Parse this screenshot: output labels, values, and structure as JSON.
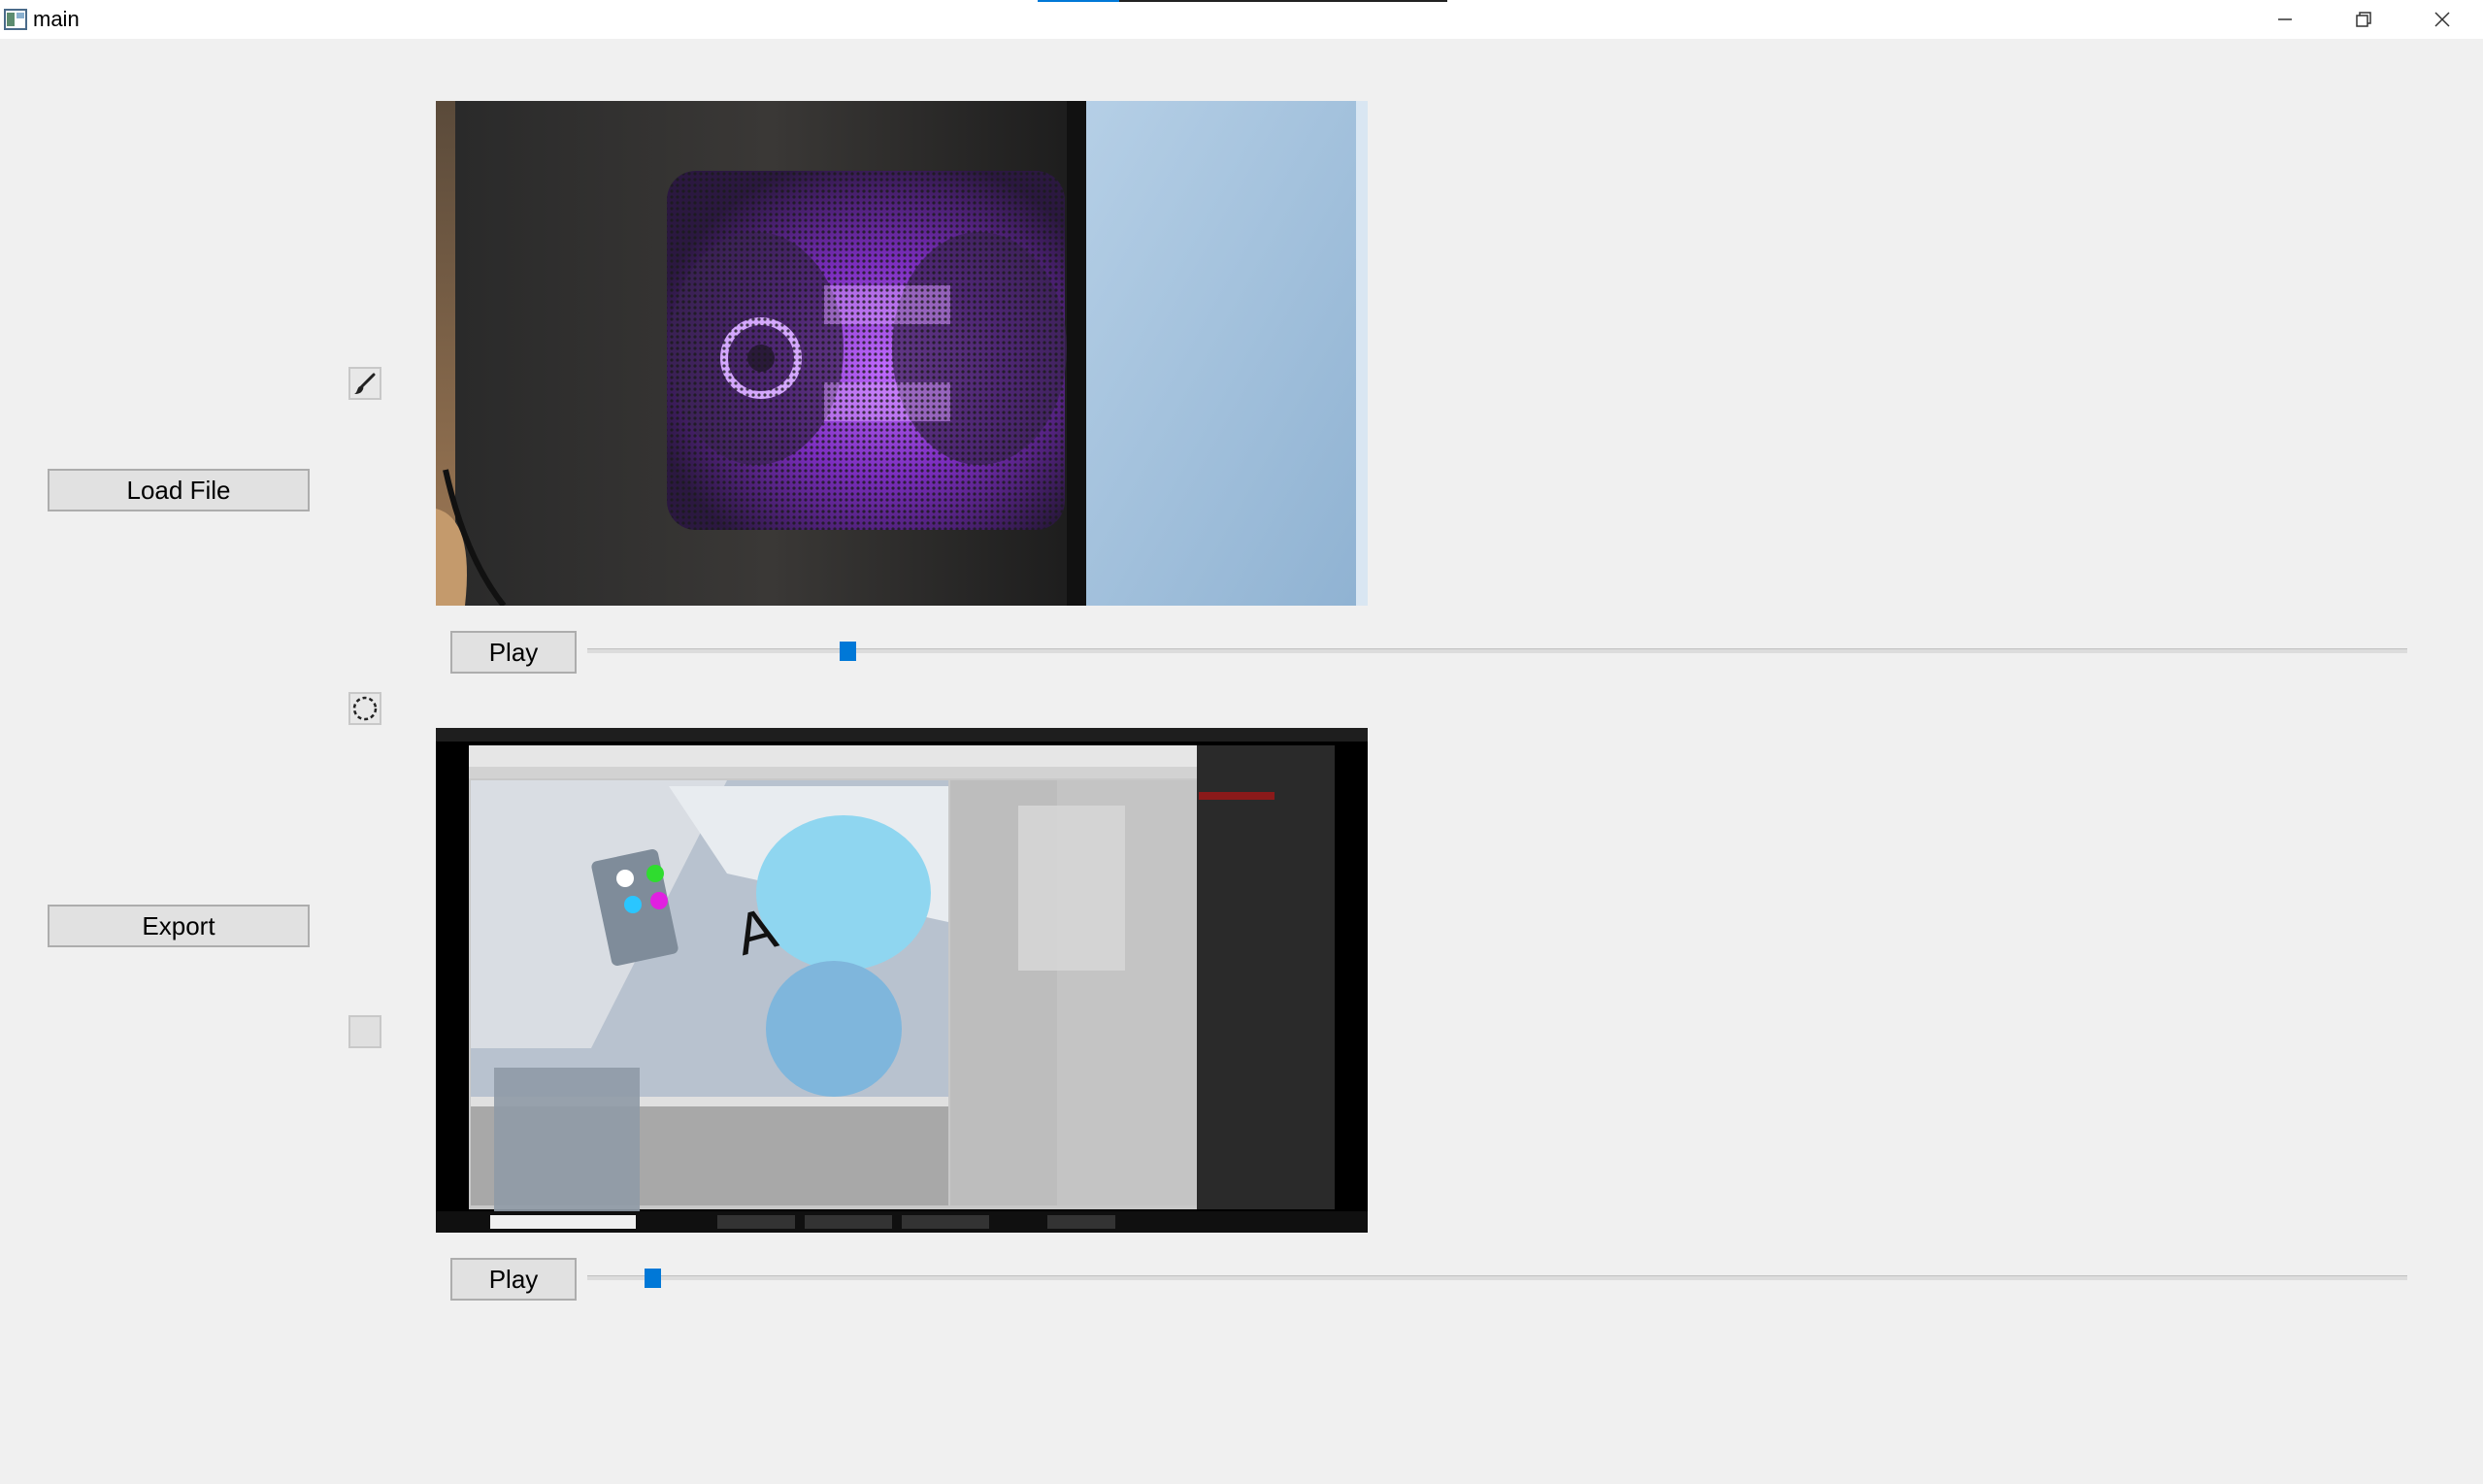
{
  "window": {
    "title": "main",
    "app_icon": "app-window-icon",
    "controls": [
      "minimize-icon",
      "restore-icon",
      "close-icon"
    ]
  },
  "buttons": {
    "load_file": "Load File",
    "export": "Export"
  },
  "tools": [
    {
      "icon": "brush-icon"
    },
    {
      "icon": "lasso-select-icon"
    },
    {
      "icon": "blank-tool"
    }
  ],
  "players": [
    {
      "play_label": "Play",
      "slider_position": 0.14,
      "content": "pc-case-purple-fan-video"
    },
    {
      "play_label": "Play",
      "slider_position": 0.032,
      "content": "unity-editor-screen-recording"
    }
  ],
  "colors": {
    "accent": "#0078d7",
    "background": "#f0f0f0",
    "button": "#e1e1e1"
  }
}
